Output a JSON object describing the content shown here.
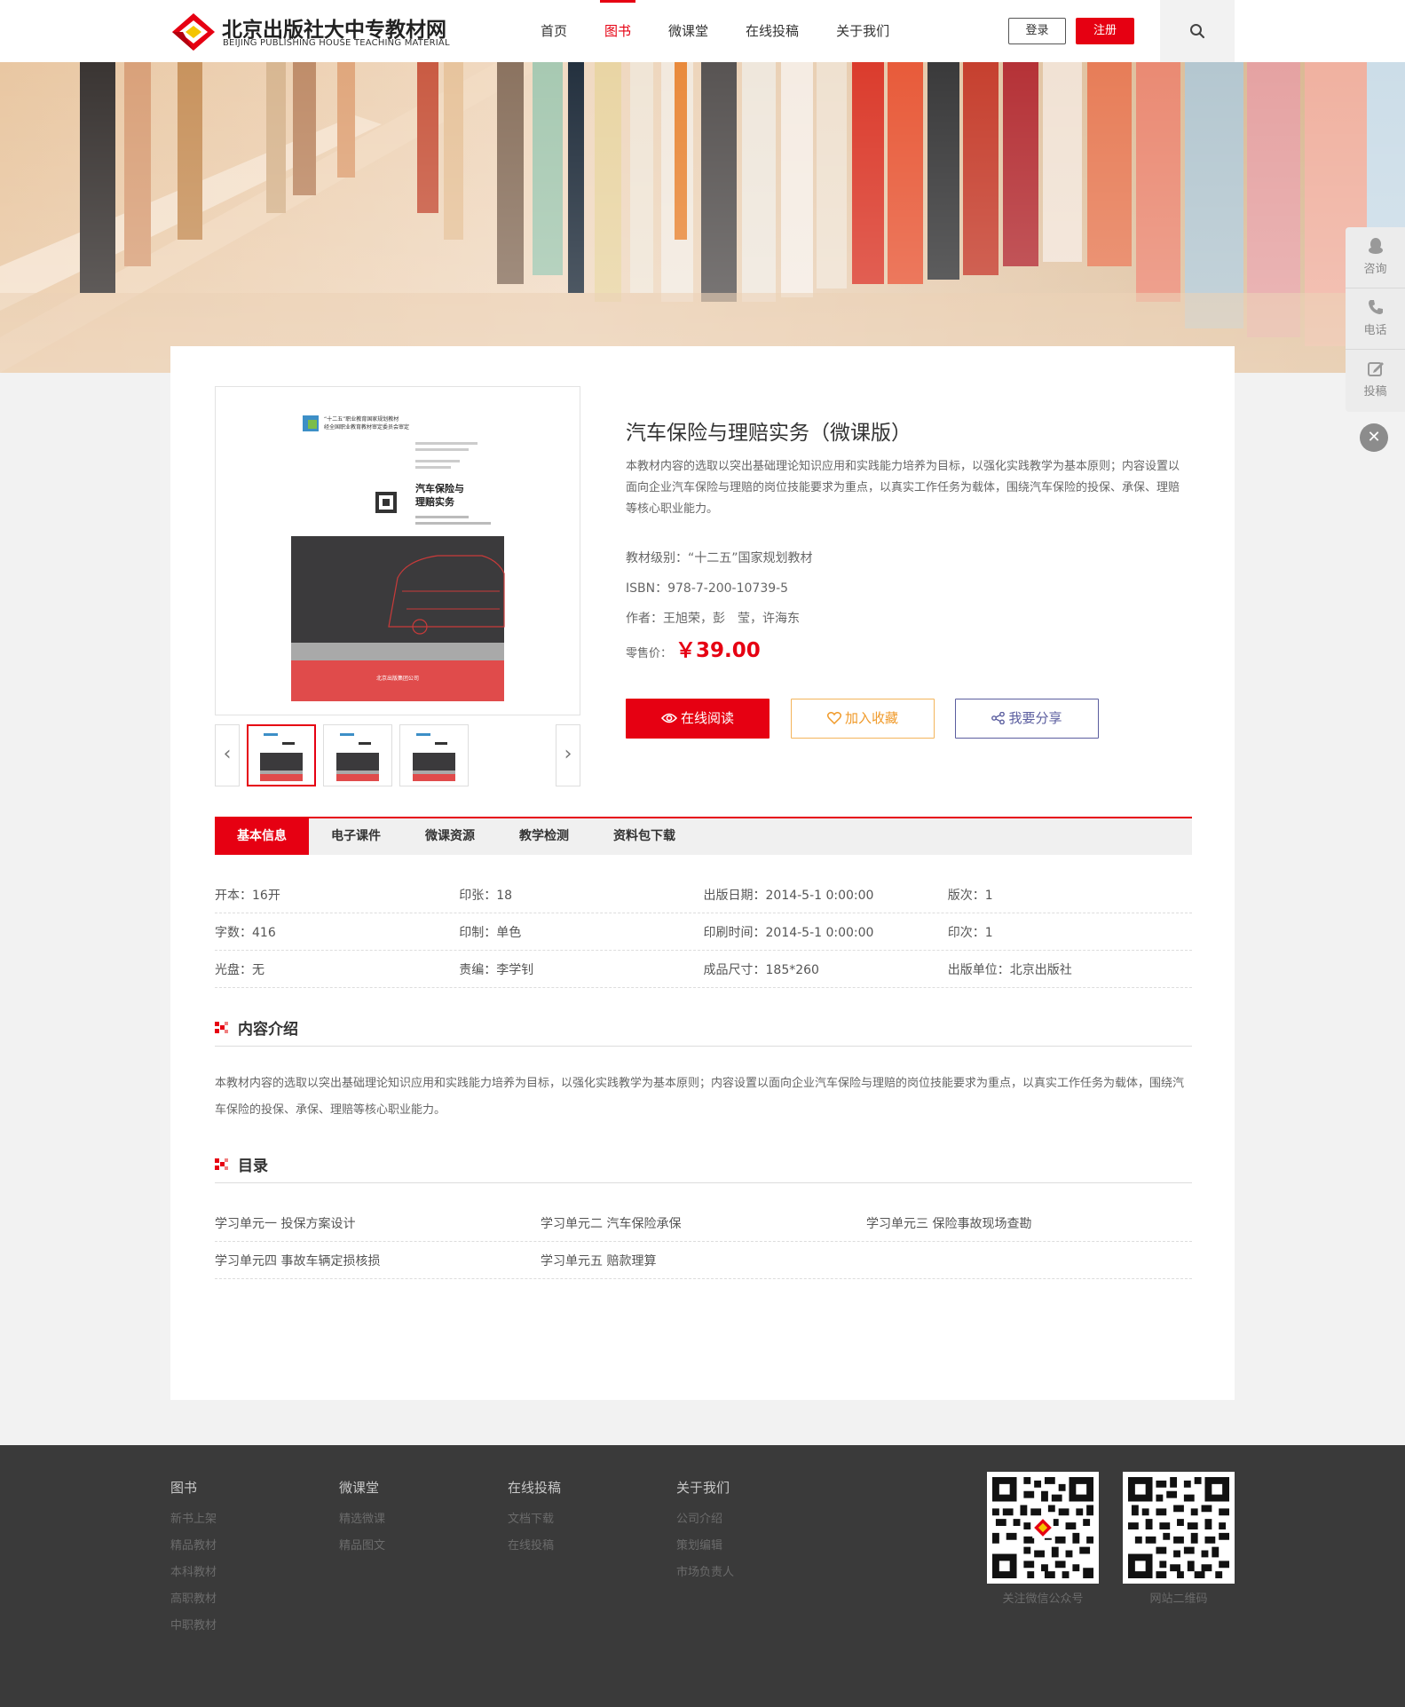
{
  "brand": {
    "name_cn": "北京出版社大中专教材网",
    "name_en": "BEIJING PUBLISHING HOUSE TEACHING MATERIAL",
    "color_primary": "#e60012"
  },
  "nav": {
    "items": [
      {
        "label": "首页"
      },
      {
        "label": "图书",
        "active": true
      },
      {
        "label": "微课堂"
      },
      {
        "label": "在线投稿"
      },
      {
        "label": "关于我们"
      }
    ]
  },
  "header": {
    "login_label": "登录",
    "register_label": "注册",
    "search_icon": "search-icon"
  },
  "side_tools": {
    "items": [
      {
        "label": "咨询",
        "icon": "qq-penguin-icon"
      },
      {
        "label": "电话",
        "icon": "phone-icon"
      },
      {
        "label": "投稿",
        "icon": "edit-icon"
      }
    ],
    "close_icon": "close-icon"
  },
  "book": {
    "title": "汽车保险与理赔实务（微课版）",
    "intro": "本教材内容的选取以突出基础理论知识应用和实践能力培养为目标，以强化实践教学为基本原则；内容设置以面向企业汽车保险与理赔的岗位技能要求为重点，以真实工作任务为载体，围绕汽车保险的投保、承保、理赔等核心职业能力。",
    "level": "教材级别：“十二五”国家规划教材",
    "isbn": "ISBN：978-7-200-10739-5",
    "authors": "作者：王旭荣，彭　莹，许海东",
    "price_label": "零售价：",
    "price": "￥39.00",
    "cover": {
      "series": "“十二五”职业教育国家规划教材",
      "subtitle_line": "经全国职业教育教材审定委员会审定",
      "cover_title_1": "汽车保险与",
      "cover_title_2": "理赔实务",
      "publisher": "北京出版集团公司"
    }
  },
  "thumbs": {
    "prev_icon": "chevron-left-icon",
    "next_icon": "chevron-right-icon"
  },
  "actions": {
    "read_label": "在线阅读",
    "fav_label": "加入收藏",
    "share_label": "我要分享"
  },
  "tabs": [
    {
      "label": "基本信息",
      "active": true
    },
    {
      "label": "电子课件"
    },
    {
      "label": "微课资源"
    },
    {
      "label": "教学检测"
    },
    {
      "label": "资料包下载"
    }
  ],
  "info": [
    [
      "开本：16开",
      "印张：18",
      "出版日期：2014-5-1 0:00:00",
      "版次：1"
    ],
    [
      "字数：416",
      "印制：单色",
      "印刷时间：2014-5-1 0:00:00",
      "印次：1"
    ],
    [
      "光盘：无",
      "责编：李学钊",
      "成品尺寸：185*260",
      "出版单位：北京出版社"
    ]
  ],
  "content_section": {
    "title": "内容介绍",
    "body": "本教材内容的选取以突出基础理论知识应用和实践能力培养为目标，以强化实践教学为基本原则；内容设置以面向企业汽车保险与理赔的岗位技能要求为重点，以真实工作任务为载体，围绕汽车保险的投保、承保、理赔等核心职业能力。"
  },
  "toc_section": {
    "title": "目录",
    "rows": [
      [
        "学习单元一  投保方案设计",
        "学习单元二  汽车保险承保",
        "学习单元三  保险事故现场查勘"
      ],
      [
        "学习单元四  事故车辆定损核损",
        "学习单元五  赔款理算"
      ]
    ]
  },
  "footer": {
    "columns": [
      {
        "title": "图书",
        "links": [
          "新书上架",
          "精品教材",
          "本科教材",
          "高职教材",
          "中职教材"
        ]
      },
      {
        "title": "微课堂",
        "links": [
          "精选微课",
          "精品图文"
        ]
      },
      {
        "title": "在线投稿",
        "links": [
          "文档下载",
          "在线投稿"
        ]
      },
      {
        "title": "关于我们",
        "links": [
          "公司介绍",
          "策划编辑",
          "市场负责人"
        ]
      }
    ],
    "qr": [
      {
        "caption": "关注微信公众号"
      },
      {
        "caption": "网站二维码"
      }
    ]
  }
}
